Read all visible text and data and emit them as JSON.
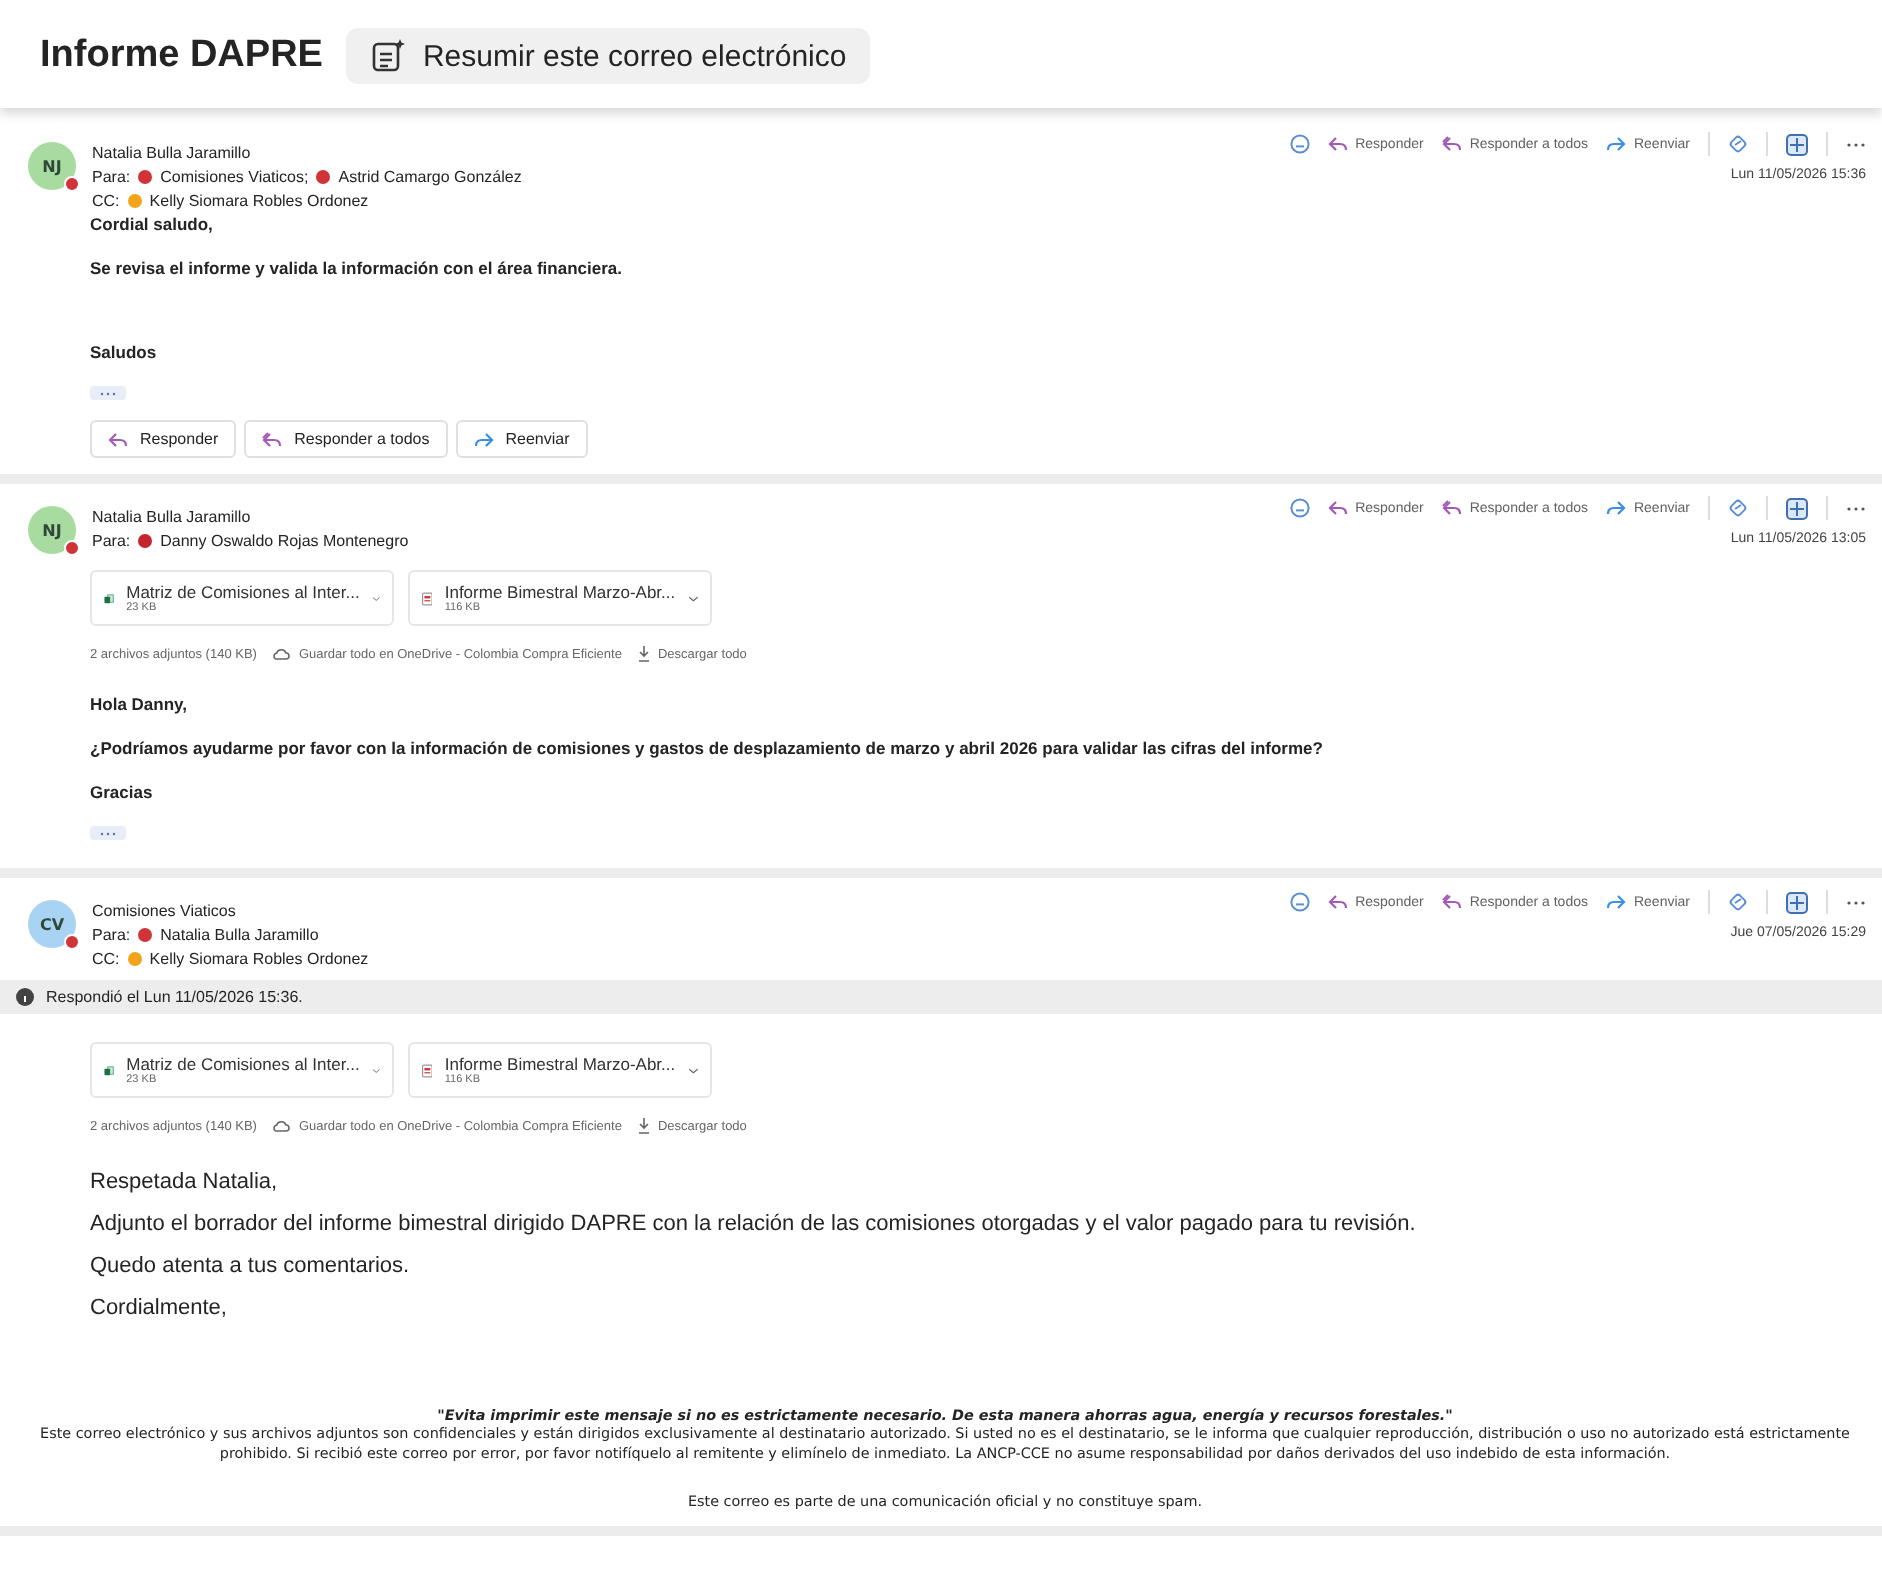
{
  "header": {
    "title": "Informe DAPRE",
    "summarize_button": "Resumir este correo electrónico"
  },
  "messages": [
    {
      "kind": "compact",
      "avatar": {
        "initials": "NJ",
        "color": "#a8dba0"
      },
      "sender": "Natalia Bulla Jaramillo",
      "to_label": "Para:",
      "to": [
        {
          "name": "Comisiones Viaticos;",
          "color": "#d13438"
        },
        {
          "name": "Astrid Camargo González",
          "color": "#d13438"
        }
      ],
      "cc_label": "CC:",
      "cc": [
        {
          "name": "Kelly Siomara Robles Ordonez",
          "color": "#f2a51a"
        }
      ],
      "actions": [
        "Responder",
        "Responder a todos",
        "Reenviar"
      ],
      "date": "Lun 11/05/2026 15:36",
      "body": [
        "Cordial saludo,",
        "Se revisa el informe y valida la información con el área financiera.",
        "Saludos"
      ],
      "show_more": true,
      "reply_buttons": [
        "Responder",
        "Responder a todos",
        "Reenviar"
      ]
    },
    {
      "kind": "compact",
      "avatar": {
        "initials": "NJ",
        "color": "#a8dba0"
      },
      "sender": "Natalia Bulla Jaramillo",
      "to_label": "Para:",
      "to": [
        {
          "name": "Danny Oswaldo Rojas Montenegro",
          "color": "#c4262e"
        }
      ],
      "actions": [
        "Responder",
        "Responder a todos",
        "Reenviar"
      ],
      "date": "Lun 11/05/2026 13:05",
      "attachments": [
        {
          "kind": "excel",
          "name": "Matriz de Comisiones al Inter...",
          "size": "23 KB"
        },
        {
          "kind": "pdf",
          "name": "Informe Bimestral Marzo-Abr...",
          "size": "116 KB"
        }
      ],
      "attachment_bar": {
        "summary": "2 archivos adjuntos (140 KB)",
        "save": "Guardar todo en OneDrive - Colombia Compra Eficiente",
        "download": "Descargar todo"
      },
      "body": [
        "Hola Danny,",
        "¿Podríamos ayudarme por favor con la información de comisiones y gastos de desplazamiento de marzo y abril 2026 para validar las cifras del informe?",
        "Gracias"
      ],
      "show_more": true
    },
    {
      "kind": "full",
      "avatar": {
        "initials": "CV",
        "color": "#a9d3f2"
      },
      "sender": "Comisiones Viaticos",
      "to_label": "Para:",
      "to": [
        {
          "name": "Natalia Bulla Jaramillo",
          "color": "#d13438"
        }
      ],
      "cc_label": "CC:",
      "cc": [
        {
          "name": "Kelly Siomara Robles Ordonez",
          "color": "#f2a51a"
        }
      ],
      "actions": [
        "Responder",
        "Responder a todos",
        "Reenviar"
      ],
      "date": "Jue 07/05/2026 15:29",
      "notice": "Respondió el Lun 11/05/2026 15:36.",
      "attachments": [
        {
          "kind": "excel",
          "name": "Matriz de Comisiones al Inter...",
          "size": "23 KB"
        },
        {
          "kind": "pdf",
          "name": "Informe Bimestral Marzo-Abr...",
          "size": "116 KB"
        }
      ],
      "attachment_bar": {
        "summary": "2 archivos adjuntos (140 KB)",
        "save": "Guardar todo en OneDrive - Colombia Compra Eficiente",
        "download": "Descargar todo"
      },
      "body": [
        "Respetada Natalia,",
        "Adjunto el borrador del informe bimestral dirigido DAPRE con la relación de las comisiones otorgadas y el valor pagado para tu revisión.",
        "Quedo atenta a tus comentarios.",
        "Cordialmente,"
      ],
      "disclaimer": {
        "quote": "\"Evita imprimir este mensaje si no es estrictamente necesario. De esta manera ahorras agua, energía y recursos forestales.\"",
        "text": "Este correo electrónico y sus archivos adjuntos son confidenciales y están dirigidos exclusivamente al destinatario autorizado. Si usted no es el destinatario, se le informa que cualquier reproducción, distribución o uso no autorizado está estrictamente prohibido. Si recibió este correo por error, por favor notifíquelo al remitente y elimínelo de inmediato. La ANCP-CCE no asume responsabilidad por daños derivados del uso indebido de esta información.",
        "spam": "Este correo es parte de una comunicación oficial y no constituye spam."
      }
    }
  ]
}
